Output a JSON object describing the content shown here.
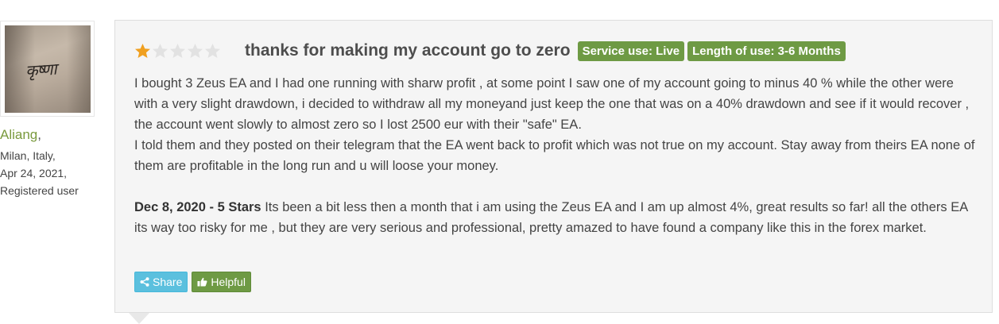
{
  "user": {
    "name": "Aliang",
    "location": "Milan, Italy,",
    "date": "Apr 24, 2021,",
    "status": "Registered user",
    "avatar_tattoo_text": "कृष्णा"
  },
  "review": {
    "rating": 1,
    "rating_max": 5,
    "title": "thanks for making my account go to zero",
    "tags": [
      {
        "label": "Service use: Live"
      },
      {
        "label": "Length of use: 3-6 Months"
      }
    ],
    "body_paragraph_1": "I bought 3 Zeus EA and I had one running with sharw profit , at some point I saw one of my account going to minus 40 % while the other were with a very slight drawdown, i decided to withdraw all my moneyand just keep the one that was on a 40% drawdown and see if it would recover , the account went slowly to almost zero so I lost 2500 eur with their \"safe\" EA.",
    "body_paragraph_2": "I told them and they posted on their telegram that the EA went back to profit which was not true on my account. Stay away from theirs EA none of them are profitable in the long run and u will loose your money.",
    "update_date": "Dec 8, 2020 - 5 Stars",
    "update_text": " Its been a bit less then a month that i am using the Zeus EA and I am up almost 4%, great results so far! all the others EA its way too risky for me , but they are very serious and professional, pretty amazed to have found a company like this in the forex market."
  },
  "actions": {
    "share_label": "Share",
    "helpful_label": "Helpful"
  },
  "colors": {
    "star_filled": "#f0a020",
    "star_empty": "#e2e2e2",
    "tag_green": "#6e9a44",
    "share_blue": "#5bc0de",
    "username_green": "#7a9a3e"
  },
  "icons": {
    "star": "star-icon",
    "share": "share-icon",
    "helpful": "thumbs-up-icon"
  }
}
